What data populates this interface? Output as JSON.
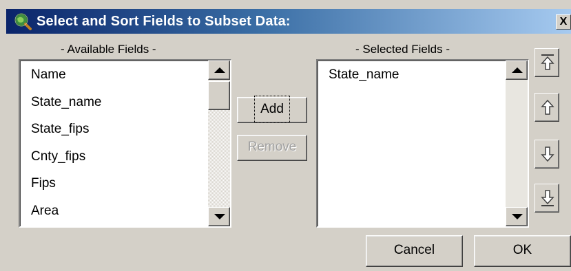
{
  "dialog": {
    "title": "Select and Sort Fields to Subset Data:",
    "close_label": "X"
  },
  "available": {
    "label": "- Available Fields -",
    "items": [
      "Name",
      "State_name",
      "State_fips",
      "Cnty_fips",
      "Fips",
      "Area"
    ]
  },
  "selected": {
    "label": "- Selected Fields -",
    "items": [
      "State_name"
    ]
  },
  "buttons": {
    "add": "Add",
    "remove": "Remove",
    "cancel": "Cancel",
    "ok": "OK"
  },
  "sort_buttons": [
    "move-to-top-icon",
    "move-up-icon",
    "move-down-icon",
    "move-to-bottom-icon"
  ],
  "colors": {
    "title_gradient_start": "#0a246a",
    "title_gradient_end": "#a6caf0",
    "face": "#d4d0c8"
  }
}
